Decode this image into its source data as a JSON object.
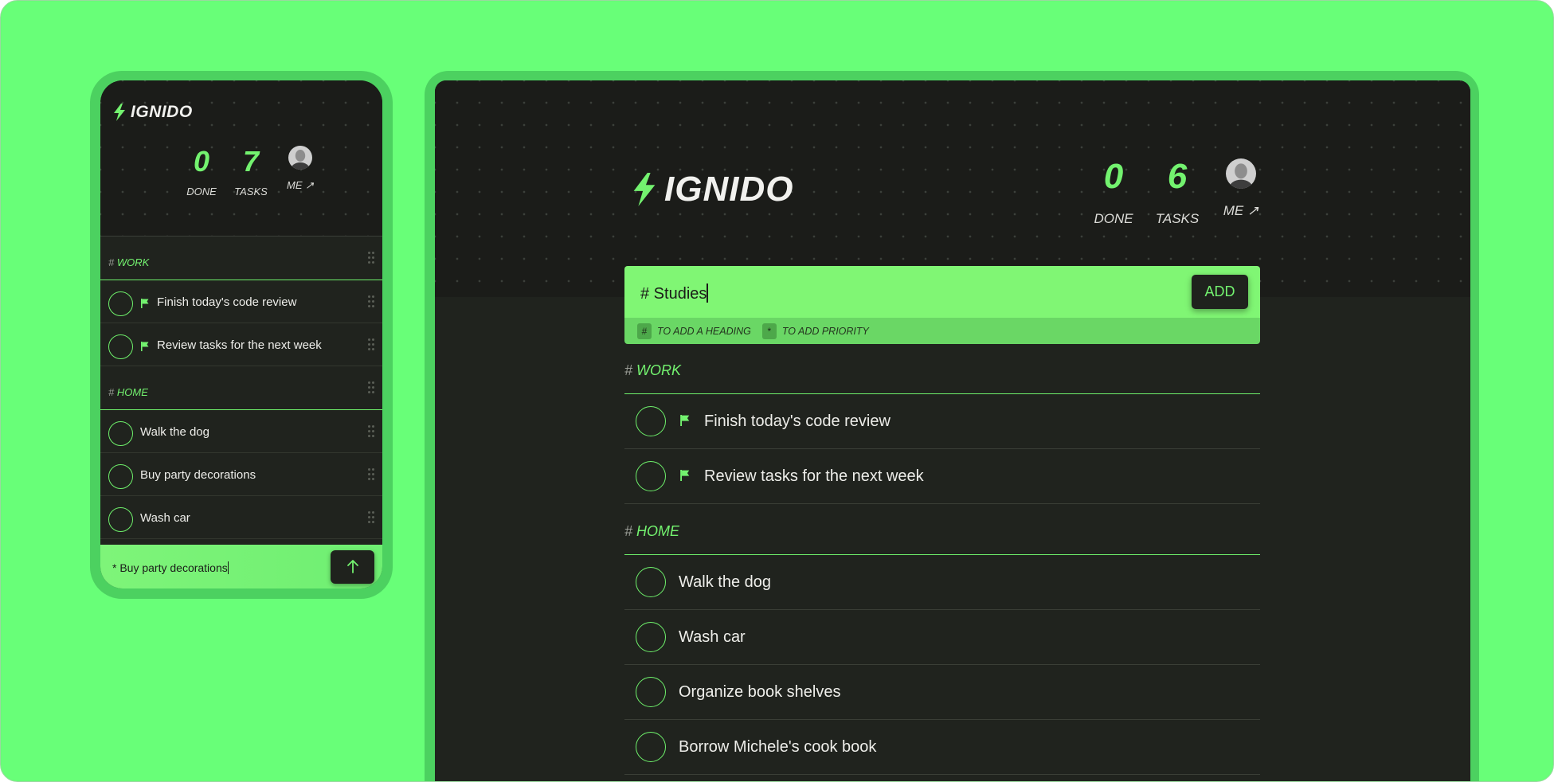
{
  "colors": {
    "background": "#68ff78",
    "accent": "#73f26f",
    "surface": "#20231e"
  },
  "mobile": {
    "brand": "IGNIDO",
    "stats": {
      "done_value": "0",
      "done_label": "DONE",
      "tasks_value": "7",
      "tasks_label": "TASKS",
      "me_label": "ME ↗"
    },
    "sections": [
      {
        "hash": "#",
        "title": "WORK",
        "items": [
          {
            "text": "Finish today's code review",
            "priority": true
          },
          {
            "text": "Review tasks for the next week",
            "priority": true
          }
        ]
      },
      {
        "hash": "#",
        "title": "HOME",
        "items": [
          {
            "text": "Walk the dog",
            "priority": false
          },
          {
            "text": "Buy party decorations",
            "priority": false
          },
          {
            "text": "Wash car",
            "priority": false
          }
        ]
      }
    ],
    "composer": {
      "value": "* Buy party decorations",
      "send_icon": "arrow-up-icon"
    }
  },
  "desktop": {
    "brand": "IGNIDO",
    "stats": {
      "done_value": "0",
      "done_label": "DONE",
      "tasks_value": "6",
      "tasks_label": "TASKS",
      "me_label": "ME ↗"
    },
    "composer": {
      "value": "# Studies",
      "add_label": "ADD",
      "hint_heading_key": "#",
      "hint_heading": "TO ADD A HEADING",
      "hint_priority_key": "*",
      "hint_priority": "TO ADD PRIORITY"
    },
    "sections": [
      {
        "hash": "#",
        "title": "WORK",
        "items": [
          {
            "text": "Finish today's code review",
            "priority": true
          },
          {
            "text": "Review tasks for the next week",
            "priority": true
          }
        ]
      },
      {
        "hash": "#",
        "title": "HOME",
        "items": [
          {
            "text": "Walk the dog",
            "priority": false
          },
          {
            "text": "Wash car",
            "priority": false
          },
          {
            "text": "Organize book shelves",
            "priority": false
          },
          {
            "text": "Borrow Michele's cook book",
            "priority": false
          }
        ]
      }
    ]
  }
}
